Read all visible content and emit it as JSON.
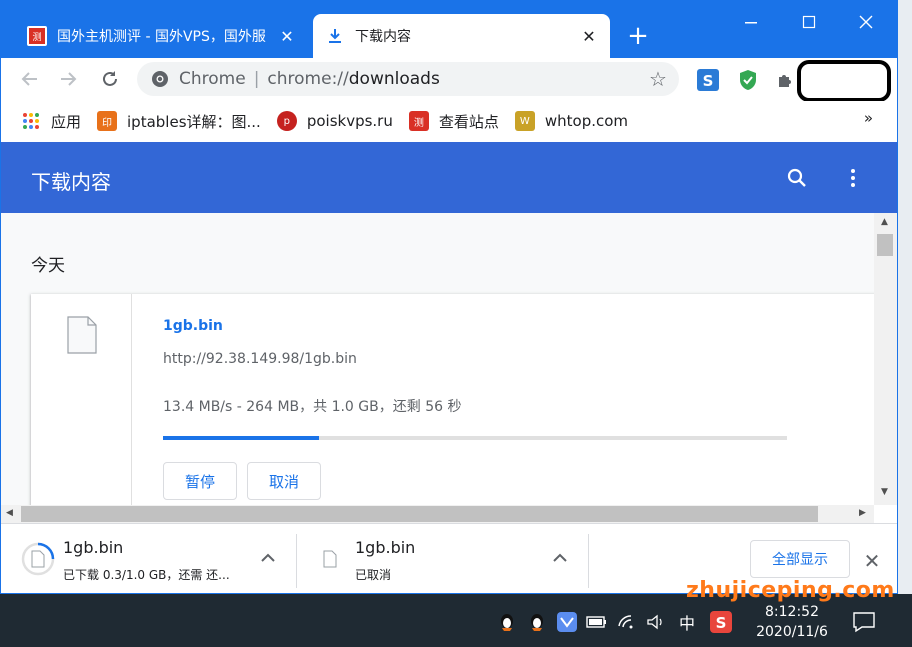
{
  "tabs": [
    {
      "title": "国外主机测评 - 国外VPS，国外服",
      "active": false
    },
    {
      "title": "下载内容",
      "active": true
    }
  ],
  "toolbar": {
    "omnibox_host": "Chrome",
    "omnibox_scheme": "chrome://",
    "omnibox_path": "downloads"
  },
  "bookmarks": [
    {
      "label": "应用",
      "icon": "apps-grid-icon",
      "color": "#ea4335"
    },
    {
      "label": "iptables详解：图...",
      "icon": "印",
      "color": "#e8711a"
    },
    {
      "label": "poiskvps.ru",
      "icon": "p",
      "color": "#c5221f"
    },
    {
      "label": "查看站点",
      "icon": "测",
      "color": "#d93025"
    },
    {
      "label": "whtop.com",
      "icon": "W",
      "color": "#c9a227"
    }
  ],
  "bookmarks_more": "»",
  "page": {
    "title": "下载内容",
    "day_label": "今天"
  },
  "download": {
    "file_name": "1gb.bin",
    "url": "http://92.38.149.98/1gb.bin",
    "status": "13.4 MB/s - 264 MB，共 1.0 GB，还剩 56 秒",
    "progress_fraction": 0.25,
    "pause_label": "暂停",
    "cancel_label": "取消"
  },
  "shelf": {
    "items": [
      {
        "name": "1gb.bin",
        "sub": "已下载 0.3/1.0 GB，还需 还..."
      },
      {
        "name": "1gb.bin",
        "sub": "已取消"
      }
    ],
    "show_all": "全部显示"
  },
  "watermark": "zhujiceping.com",
  "taskbar": {
    "time": "8:12:52",
    "date": "2020/11/6",
    "ime": "中"
  },
  "colors": {
    "accent": "#1a73e8",
    "header": "#3367d6",
    "watermark": "#ff7a1a"
  }
}
